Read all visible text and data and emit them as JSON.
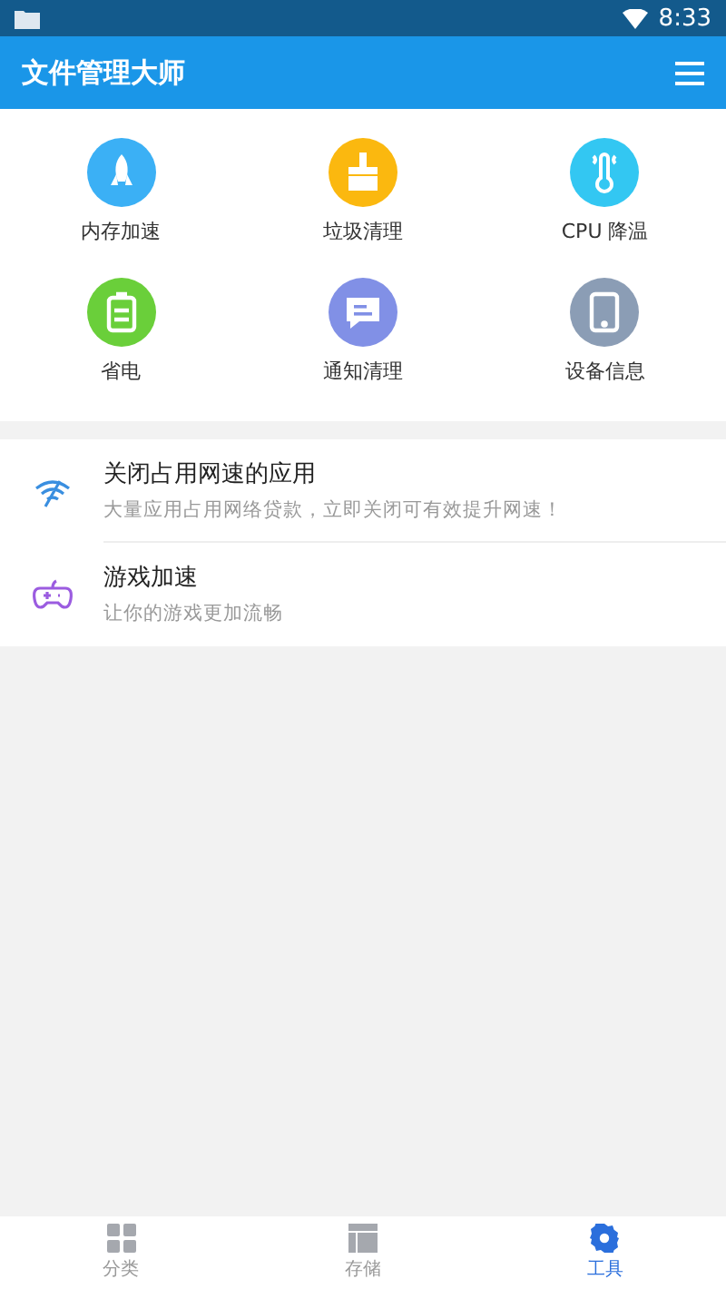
{
  "status_bar": {
    "time": "8:33"
  },
  "app_bar": {
    "title": "文件管理大师"
  },
  "tools": [
    {
      "label": "内存加速",
      "kind": "rocket",
      "color": "#3bb0f5"
    },
    {
      "label": "垃圾清理",
      "kind": "broom",
      "color": "#fbb80f"
    },
    {
      "label": "CPU 降温",
      "kind": "thermometer",
      "color": "#33c7f2"
    },
    {
      "label": "省电",
      "kind": "battery",
      "color": "#6acf3a"
    },
    {
      "label": "通知清理",
      "kind": "message",
      "color": "#8190e6"
    },
    {
      "label": "设备信息",
      "kind": "tablet",
      "color": "#8b9db5"
    }
  ],
  "features": [
    {
      "title": "关闭占用网速的应用",
      "subtitle": "大量应用占用网络贷款，立即关闭可有效提升网速！",
      "kind": "wifi"
    },
    {
      "title": "游戏加速",
      "subtitle": "让你的游戏更加流畅",
      "kind": "gamepad"
    }
  ],
  "bottom_nav": [
    {
      "label": "分类",
      "kind": "grid",
      "selected": false
    },
    {
      "label": "存储",
      "kind": "layout",
      "selected": false
    },
    {
      "label": "工具",
      "kind": "gear",
      "selected": true
    }
  ]
}
